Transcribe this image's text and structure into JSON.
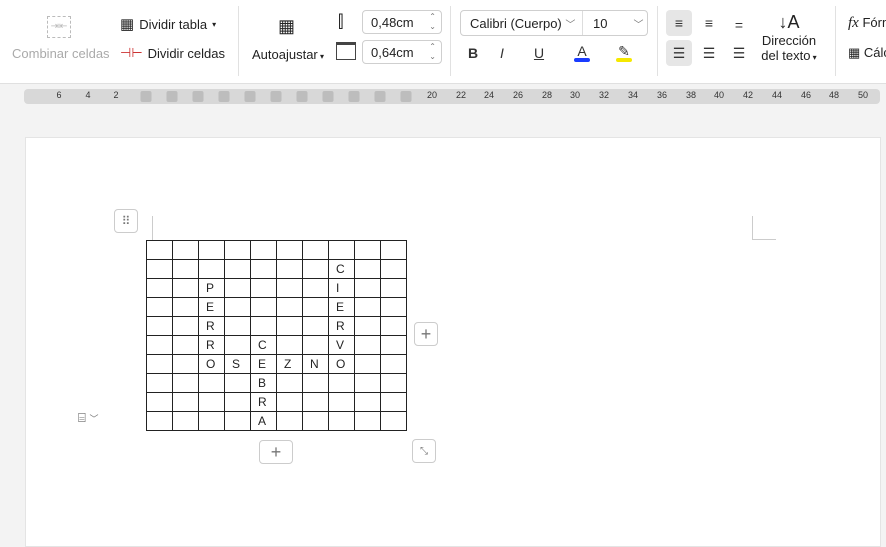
{
  "ribbon": {
    "merge_cells": "Combinar celdas",
    "split_table": "Dividir tabla",
    "split_cells": "Dividir celdas",
    "autofit": "Autoajustar",
    "row_height": "0,48cm",
    "col_width": "0,64cm",
    "font_name": "Calibri (Cuerpo)",
    "font_size": "10",
    "bold": "B",
    "italic": "I",
    "underline": "U",
    "font_color_letter": "A",
    "font_color": "#1a3cff",
    "highlight_color": "#f5e800",
    "text_direction_1": "Dirección",
    "text_direction_2": "del texto",
    "formula": "Fórmula",
    "calc": "Cálculo"
  },
  "ruler": {
    "labels": [
      "6",
      "4",
      "2",
      "20",
      "22",
      "24",
      "26",
      "28",
      "30",
      "32",
      "34",
      "36",
      "38",
      "40",
      "42",
      "44",
      "46",
      "48",
      "50"
    ]
  },
  "table": {
    "rows": [
      [
        "",
        "",
        "",
        "",
        "",
        "",
        "",
        "",
        "",
        ""
      ],
      [
        "",
        "",
        "",
        "",
        "",
        "",
        "",
        "C",
        "",
        ""
      ],
      [
        "",
        "",
        "P",
        "",
        "",
        "",
        "",
        "I",
        "",
        ""
      ],
      [
        "",
        "",
        "E",
        "",
        "",
        "",
        "",
        "E",
        "",
        ""
      ],
      [
        "",
        "",
        "R",
        "",
        "",
        "",
        "",
        "R",
        "",
        ""
      ],
      [
        "",
        "",
        "R",
        "",
        "C",
        "",
        "",
        "V",
        "",
        ""
      ],
      [
        "",
        "",
        "O",
        "S",
        "E",
        "Z",
        "N",
        "O",
        "",
        ""
      ],
      [
        "",
        "",
        "",
        "",
        "B",
        "",
        "",
        "",
        "",
        ""
      ],
      [
        "",
        "",
        "",
        "",
        "R",
        "",
        "",
        "",
        "",
        ""
      ],
      [
        "",
        "",
        "",
        "",
        "A",
        "",
        "",
        "",
        "",
        ""
      ]
    ]
  },
  "controls": {
    "add": "+"
  }
}
